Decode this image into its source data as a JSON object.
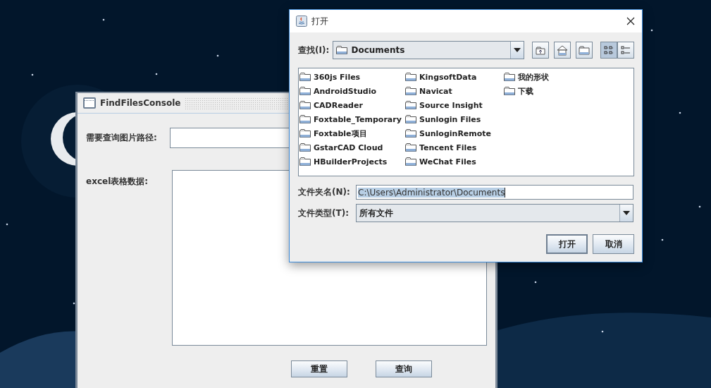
{
  "back_window": {
    "title": "FindFilesConsole",
    "path_label": "需要查询图片路径:",
    "excel_label": "excel表格数据:",
    "buttons": [
      "重置",
      "查询"
    ]
  },
  "dialog": {
    "title": "打开",
    "look_in": {
      "label": "查找(I):",
      "value": "Documents"
    },
    "toolbar": [
      {
        "kind": "up",
        "selected": false
      },
      {
        "kind": "home",
        "selected": false
      },
      {
        "kind": "new-folder",
        "selected": false
      },
      {
        "kind": "list",
        "selected": true
      },
      {
        "kind": "details",
        "selected": false
      }
    ],
    "files": [
      "360js Files",
      "AndroidStudio",
      "CADReader",
      "Foxtable_Temporary",
      "Foxtable项目",
      "GstarCAD Cloud",
      "HBuilderProjects",
      "KingsoftData",
      "Navicat",
      "Source Insight",
      "Sunlogin Files",
      "SunloginRemote",
      "Tencent Files",
      "WeChat Files",
      "我的形状",
      "下载"
    ],
    "file_name": {
      "label": "文件夹名(N):",
      "value": "C:\\Users\\Administrator\\Documents",
      "text_selected": true
    },
    "file_type": {
      "label": "文件类型(T):",
      "value": "所有文件"
    },
    "buttons": [
      {
        "label": "打开",
        "default": true
      },
      {
        "label": "取消",
        "default": false
      }
    ]
  }
}
